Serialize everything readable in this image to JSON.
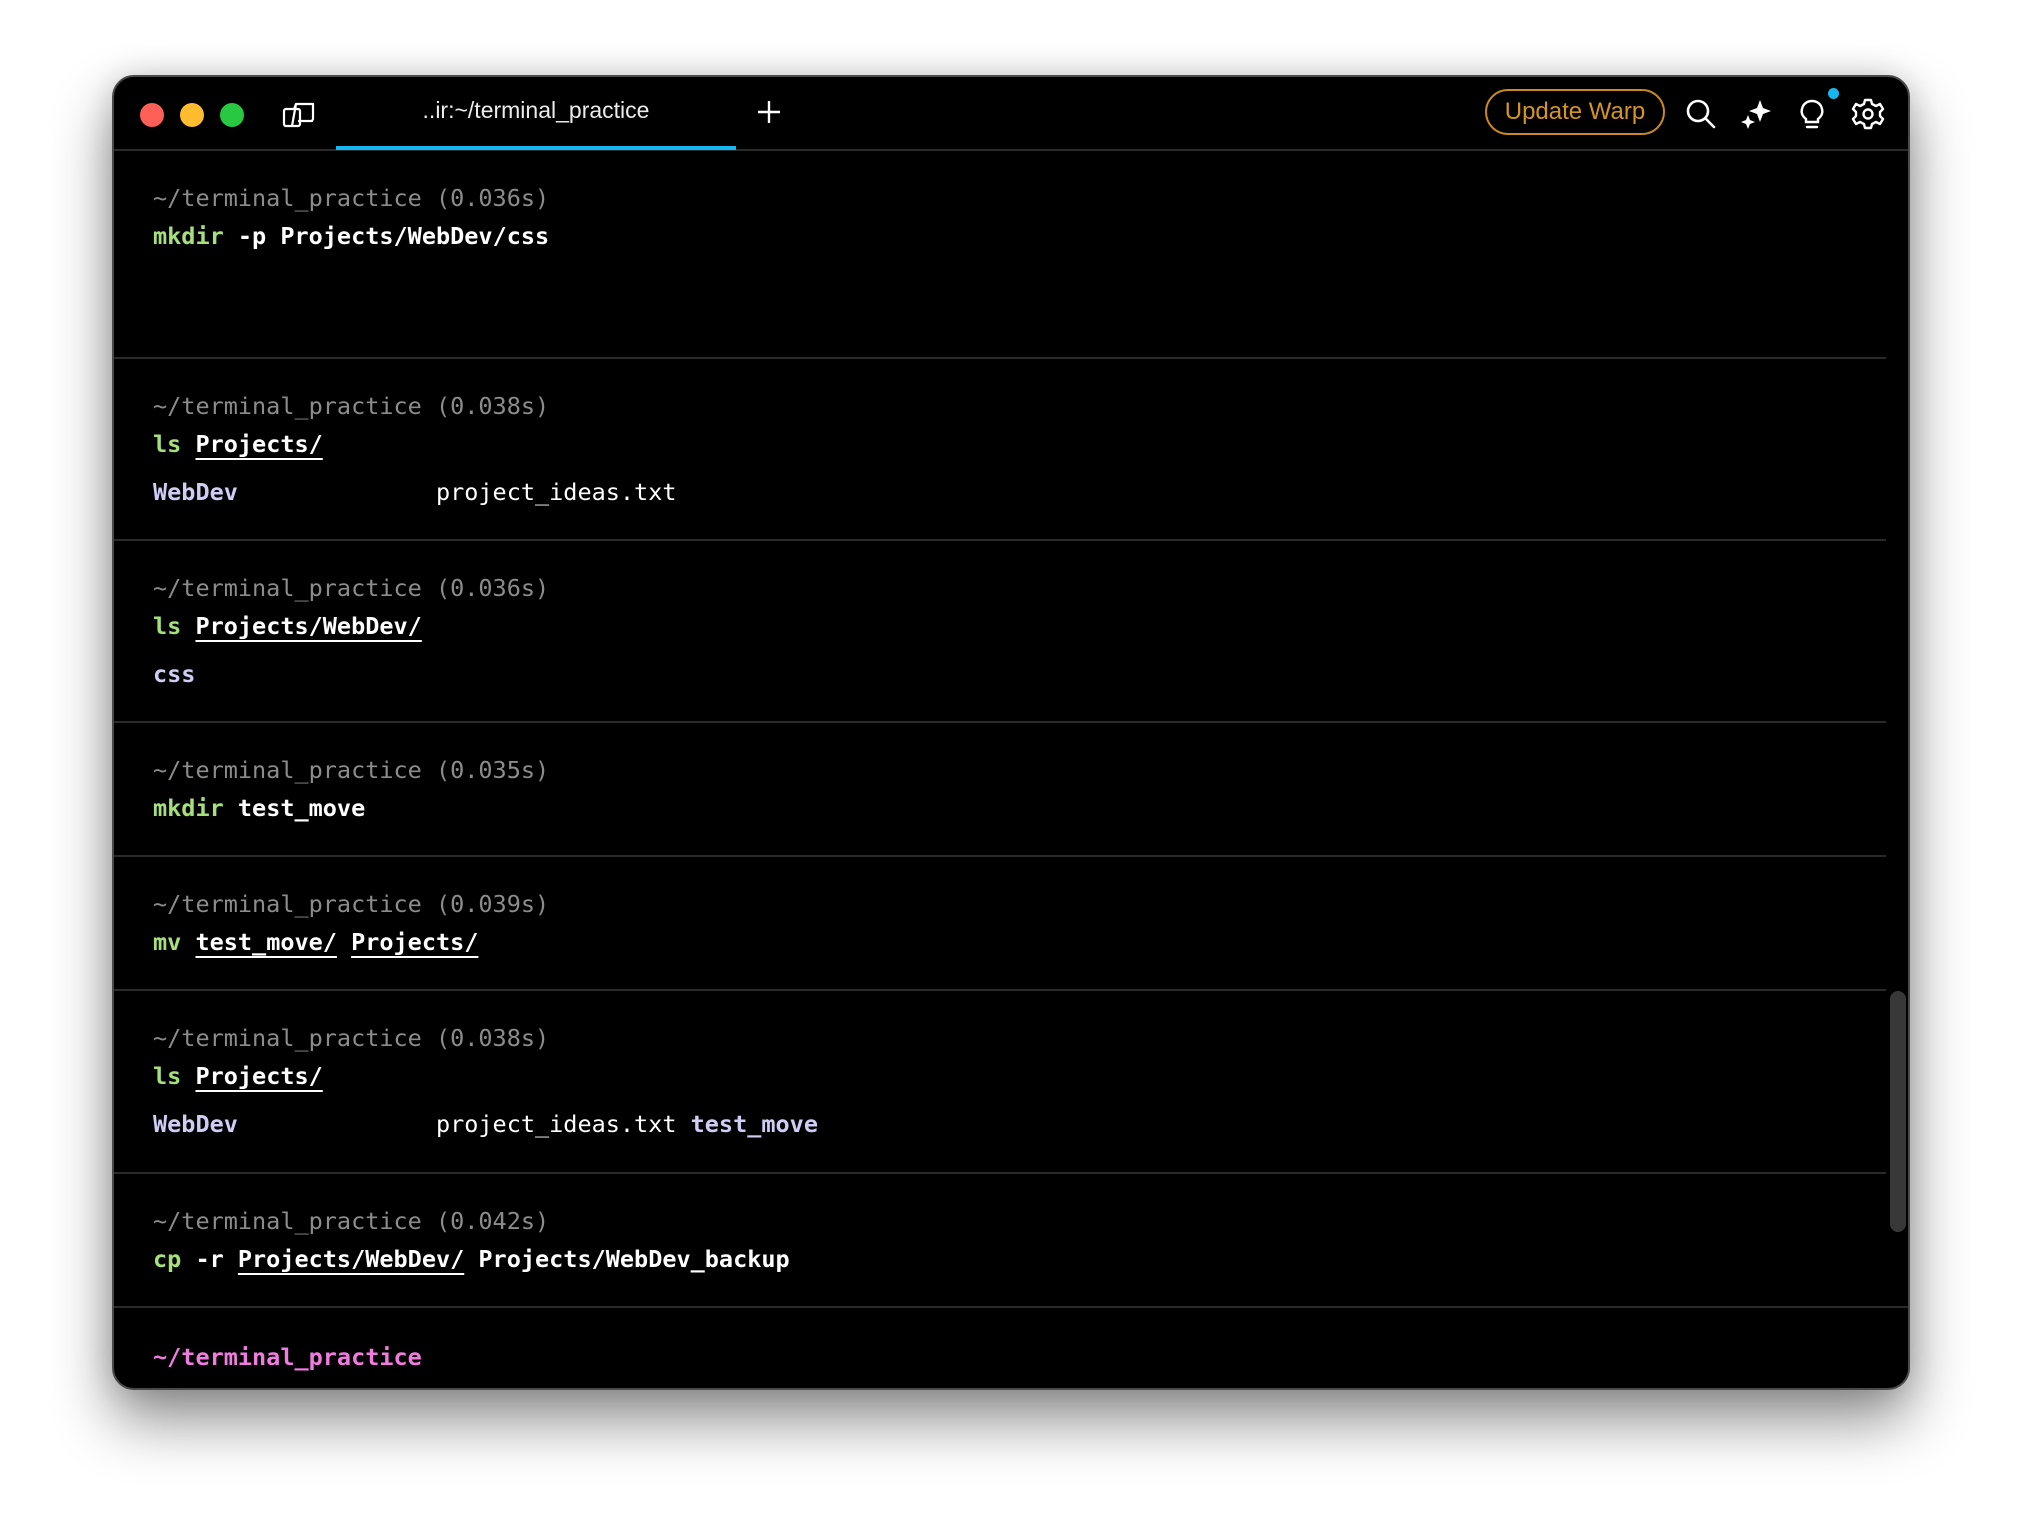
{
  "window": {
    "traffic_lights": [
      "close",
      "minimize",
      "maximize"
    ],
    "tab": {
      "label": "..ir:~/terminal_practice",
      "active": true
    },
    "new_tab_icon": "plus-icon",
    "update_button": "Update Warp",
    "toolbar_icons": [
      "search-icon",
      "sparkle-ai-icon",
      "lightbulb-icon",
      "gear-icon"
    ],
    "notification_dot": true,
    "colors": {
      "accent": "#16b6f0",
      "update": "#d69420",
      "command_keyword": "#a6e07a",
      "directory": "#cfcdf5",
      "prompt": "#f07ce0",
      "header": "#8c8c8c"
    }
  },
  "blocks": [
    {
      "header": "~/terminal_practice (0.036s)",
      "cmd": "mkdir",
      "args": [
        {
          "t": " -p Projects/WebDev/css",
          "u": false
        }
      ],
      "output": []
    },
    {
      "header": "~/terminal_practice (0.038s)",
      "cmd": "ls",
      "args": [
        {
          "t": " ",
          "u": false
        },
        {
          "t": "Projects/",
          "u": true
        }
      ],
      "output": [
        {
          "t": "WebDev",
          "dir": true
        },
        {
          "t": "project_ideas.txt",
          "dir": false
        }
      ]
    },
    {
      "header": "~/terminal_practice (0.036s)",
      "cmd": "ls",
      "args": [
        {
          "t": " ",
          "u": false
        },
        {
          "t": "Projects/WebDev/",
          "u": true
        }
      ],
      "output": [
        {
          "t": "css",
          "dir": true
        }
      ]
    },
    {
      "header": "~/terminal_practice (0.035s)",
      "cmd": "mkdir",
      "args": [
        {
          "t": " test_move",
          "u": false
        }
      ],
      "output": []
    },
    {
      "header": "~/terminal_practice (0.039s)",
      "cmd": "mv",
      "args": [
        {
          "t": " ",
          "u": false
        },
        {
          "t": "test_move/",
          "u": true
        },
        {
          "t": " ",
          "u": false
        },
        {
          "t": "Projects/",
          "u": true
        }
      ],
      "output": []
    },
    {
      "header": "~/terminal_practice (0.038s)",
      "cmd": "ls",
      "args": [
        {
          "t": " ",
          "u": false
        },
        {
          "t": "Projects/",
          "u": true
        }
      ],
      "output": [
        {
          "t": "WebDev",
          "dir": true
        },
        {
          "t": "project_ideas.txt",
          "dir": false
        },
        {
          "t": "test_move",
          "dir": true
        }
      ]
    },
    {
      "header": "~/terminal_practice (0.042s)",
      "cmd": "cp",
      "args": [
        {
          "t": " -r ",
          "u": false
        },
        {
          "t": "Projects/WebDev/",
          "u": true
        },
        {
          "t": " Projects/WebDev_backup",
          "u": false
        }
      ],
      "output": []
    }
  ],
  "prompt": "~/terminal_practice"
}
